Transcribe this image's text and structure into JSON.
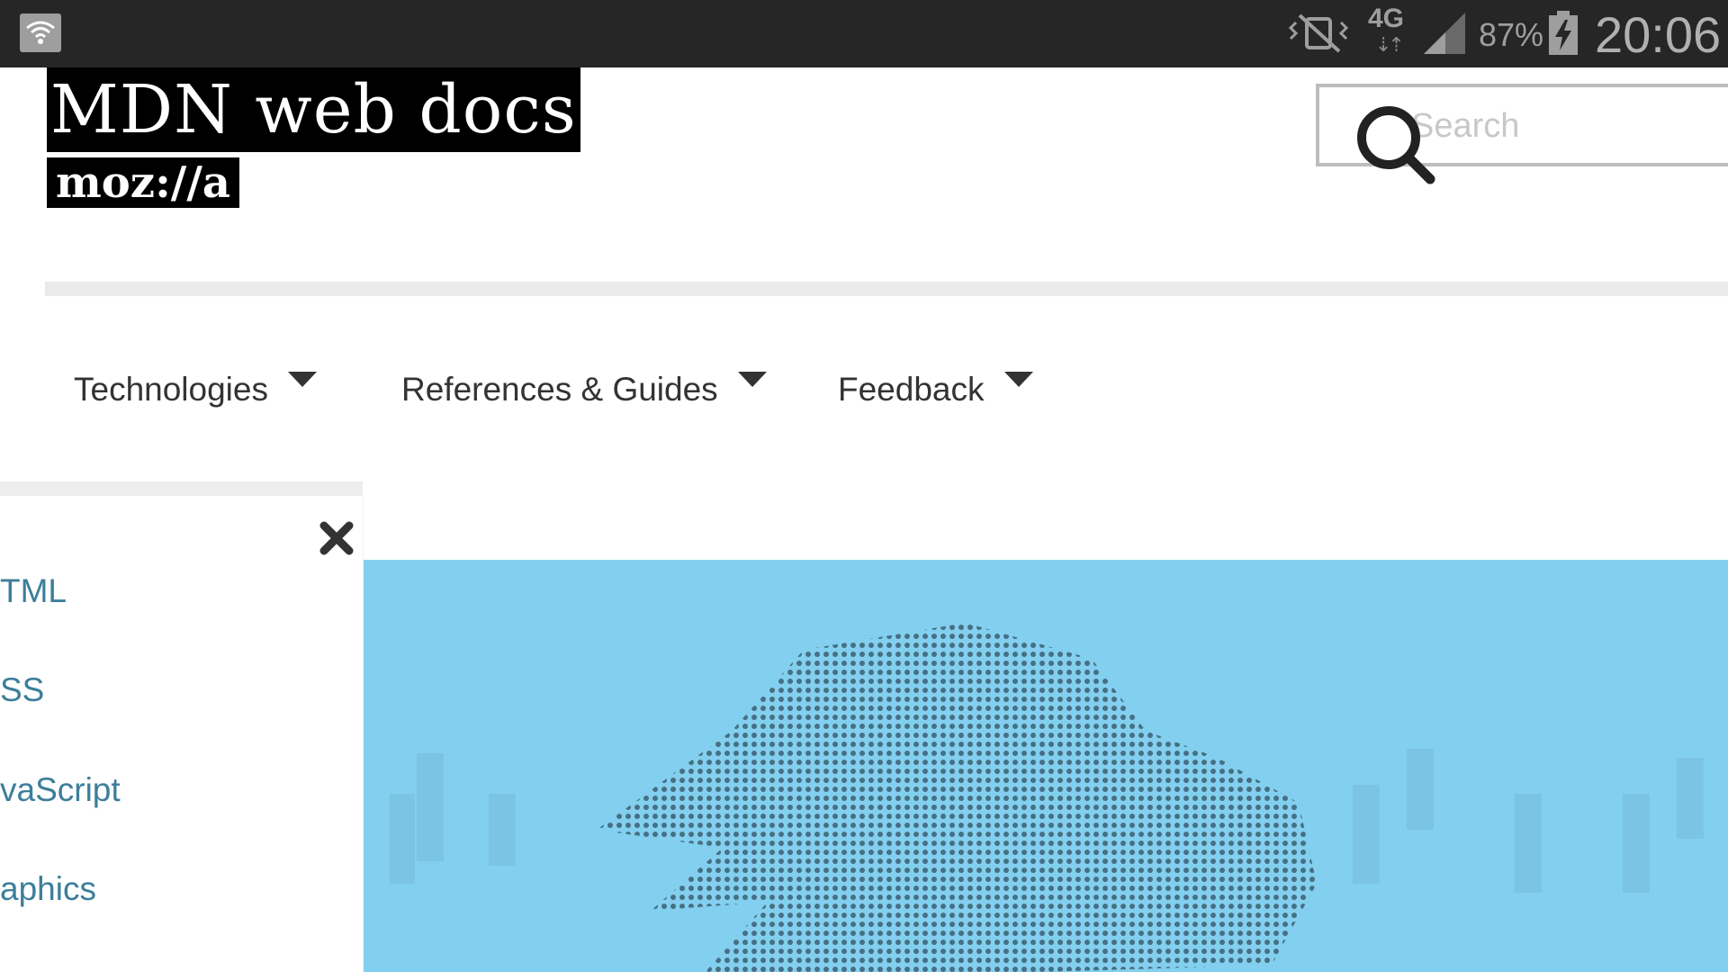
{
  "status_bar": {
    "network": "4G",
    "network_arrows": "⇣⇡",
    "battery_percent": "87%",
    "time": "20:06",
    "icons": [
      "wifi-icon",
      "vibrate-icon",
      "signal-icon",
      "battery-charging-icon"
    ]
  },
  "header": {
    "logo_title": "MDN web docs",
    "logo_moz": "moz://a",
    "search_placeholder": "Search"
  },
  "nav": {
    "items": [
      {
        "label": "Technologies"
      },
      {
        "label": "References & Guides"
      },
      {
        "label": "Feedback"
      }
    ]
  },
  "drawer": {
    "links": [
      {
        "label": "TML"
      },
      {
        "label": "SS"
      },
      {
        "label": "vaScript"
      },
      {
        "label": "aphics"
      }
    ]
  },
  "colors": {
    "hero_bg": "#83cfef",
    "link": "#3d7e9a",
    "status_bar": "#262626"
  }
}
